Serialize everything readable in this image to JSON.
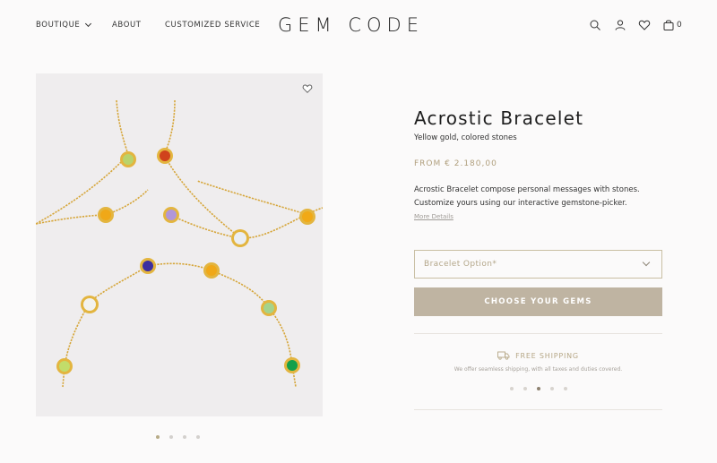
{
  "header": {
    "nav": [
      {
        "label": "BOUTIQUE"
      },
      {
        "label": "ABOUT"
      },
      {
        "label": "CUSTOMIZED SERVICE"
      }
    ],
    "logo": "GEM CODE",
    "cart_count": "0",
    "icons": [
      "search-icon",
      "account-icon",
      "wishlist-icon",
      "cart-icon"
    ]
  },
  "gallery": {
    "slide_count": 4,
    "active_slide": 1,
    "icons": [
      "heart-icon"
    ]
  },
  "product": {
    "title": "Acrostic Bracelet",
    "subtitle": "Yellow gold, colored stones",
    "price": "FROM € 2.180,00",
    "description": "Acrostic Bracelet compose personal messages with stones. Customize yours using our interactive gemstone-picker.",
    "more_details": "More Details",
    "select_placeholder": "Bracelet Option*",
    "cta_label": "CHOOSE YOUR GEMS"
  },
  "shipping": {
    "title": "FREE SHIPPING",
    "subtitle": "We offer seamless shipping, with all taxes and duties covered.",
    "slide_count": 5,
    "active_slide": 3,
    "icon": "truck-icon"
  },
  "colors": {
    "accent": "#b09f7d",
    "button": "#bfb4a2",
    "gold": "#d9a934"
  }
}
